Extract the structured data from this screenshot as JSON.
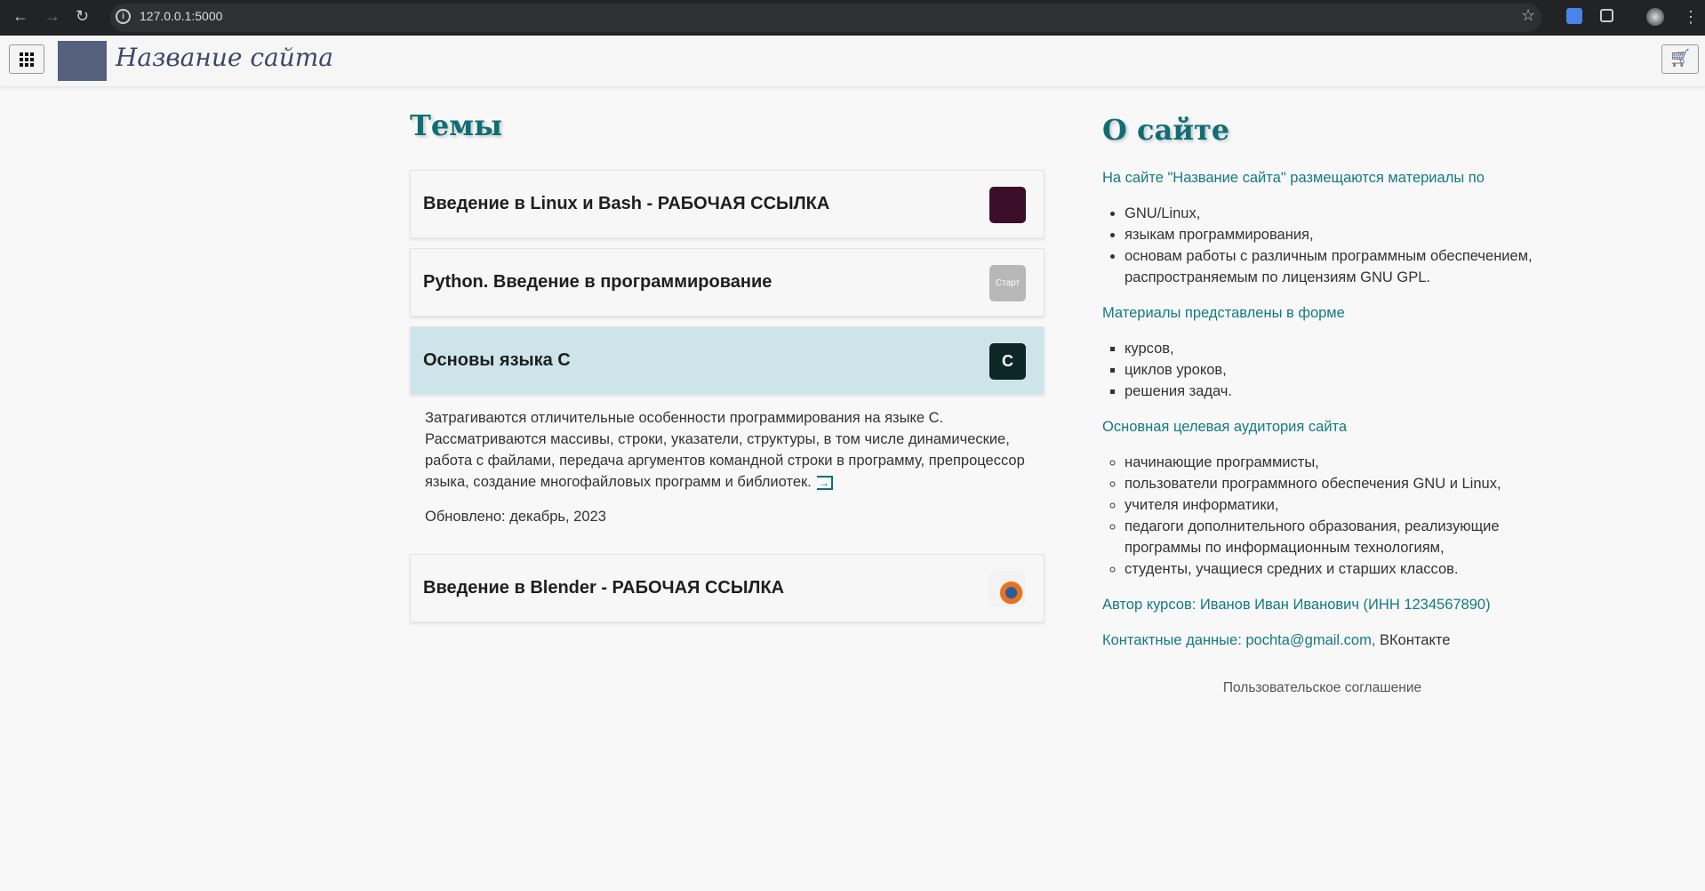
{
  "browser": {
    "url": "127.0.0.1:5000"
  },
  "header": {
    "site_title": "Название сайта"
  },
  "topics": {
    "heading": "Темы",
    "items": [
      {
        "title": "Введение в Linux и Bash - РАБОЧАЯ ССЫЛКА",
        "icon": "linux-bash-icon"
      },
      {
        "title": "Python. Введение в программирование",
        "icon": "python-start-icon",
        "icon_text": "Старт"
      },
      {
        "title": "Основы языка С",
        "icon": "c-language-icon",
        "icon_text": "C"
      },
      {
        "title": "Введение в Blender - РАБОЧАЯ ССЫЛКА",
        "icon": "blender-icon"
      }
    ],
    "expanded": {
      "description": "Затрагиваются отличительные особенности программирования на языке С. Рассматриваются массивы, строки, указатели, структуры, в том числе динамические, работа с файлами, передача аргументов командной строки в программу, препроцессор языка, создание многофайловых программ и библиотек.",
      "link_icon": "→",
      "updated": "Обновлено: декабрь, 2023"
    }
  },
  "about": {
    "heading": "О сайте",
    "intro": "На сайте \"Название сайта\" размещаются материалы по",
    "subjects": [
      "GNU/Linux,",
      "языкам программирования,",
      "основам работы с различным программным обеспечением, распространяемым по лицензиям GNU GPL."
    ],
    "forms_intro": "Материалы представлены в форме",
    "forms": [
      "курсов,",
      "циклов уроков,",
      "решения задач."
    ],
    "audience_intro": "Основная целевая аудитория сайта",
    "audience": [
      "начинающие программисты,",
      "пользователи программного обеспечения GNU и Linux,",
      "учителя информатики,",
      "педагоги дополнительного образования, реализующие программы по информационным технологиям,",
      "студенты, учащиеся средних и старших классов."
    ],
    "author": "Автор курсов: Иванов Иван Иванович (ИНН 1234567890)",
    "contacts_label": "Контактные данные: pochta@gmail.com,",
    "contacts_vk": "ВКонтакте"
  },
  "footer": {
    "agreement": "Пользовательское соглашение"
  },
  "colors": {
    "accent": "#0f6e74",
    "active_card": "#cde5ea",
    "logo": "#55607e"
  }
}
